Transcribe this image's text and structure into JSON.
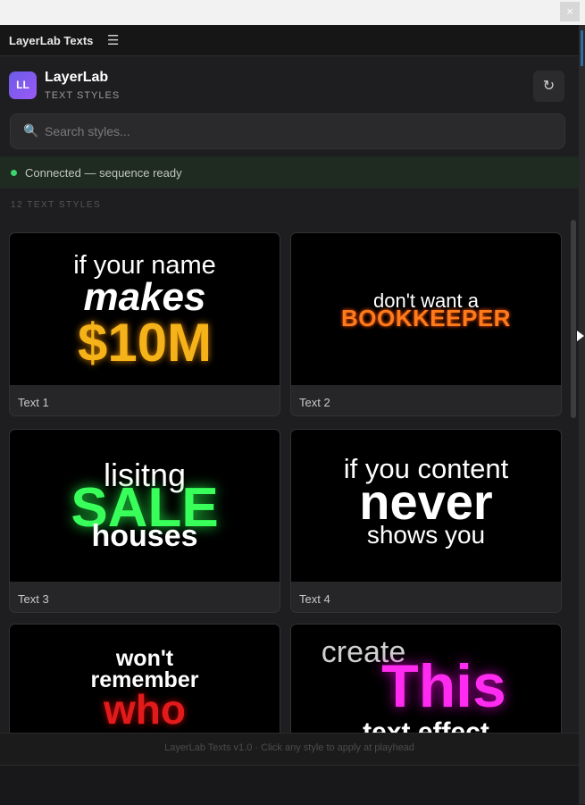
{
  "window": {
    "close_glyph": "×"
  },
  "titlebar": {
    "title": "LayerLab Texts",
    "menu_icon": "hamburger-menu-icon"
  },
  "header": {
    "logo_text": "LL",
    "brand": "LayerLab",
    "subtitle": "TEXT STYLES",
    "refresh_icon": "refresh-icon"
  },
  "search": {
    "placeholder": "Search styles...",
    "icon": "search-icon"
  },
  "status": {
    "text": "Connected — sequence ready",
    "color": "#3ad46f"
  },
  "list": {
    "count_label": "12 TEXT STYLES"
  },
  "cards": [
    {
      "label": "Text 1",
      "lines": [
        "if your name",
        "makes",
        "$10M"
      ]
    },
    {
      "label": "Text 2",
      "lines": [
        "don't want a",
        "BOOKKEEPER"
      ]
    },
    {
      "label": "Text 3",
      "lines": [
        "lisitng",
        "SALE",
        "houses"
      ]
    },
    {
      "label": "Text 4",
      "lines": [
        "if you content",
        "never",
        "shows you"
      ]
    },
    {
      "label": "",
      "lines": [
        "won't",
        "remember",
        "who"
      ]
    },
    {
      "label": "",
      "lines": [
        "create",
        "This",
        "text effect"
      ]
    }
  ],
  "footer": {
    "text": "LayerLab Texts v1.0 · Click any style to apply at playhead"
  },
  "colors": {
    "accent": "#7b5cf0",
    "gold": "#f5b319",
    "orange": "#ff7a1a",
    "neon_green": "#39ff5a",
    "red": "#e11b1b",
    "magenta": "#ff2bf0"
  }
}
